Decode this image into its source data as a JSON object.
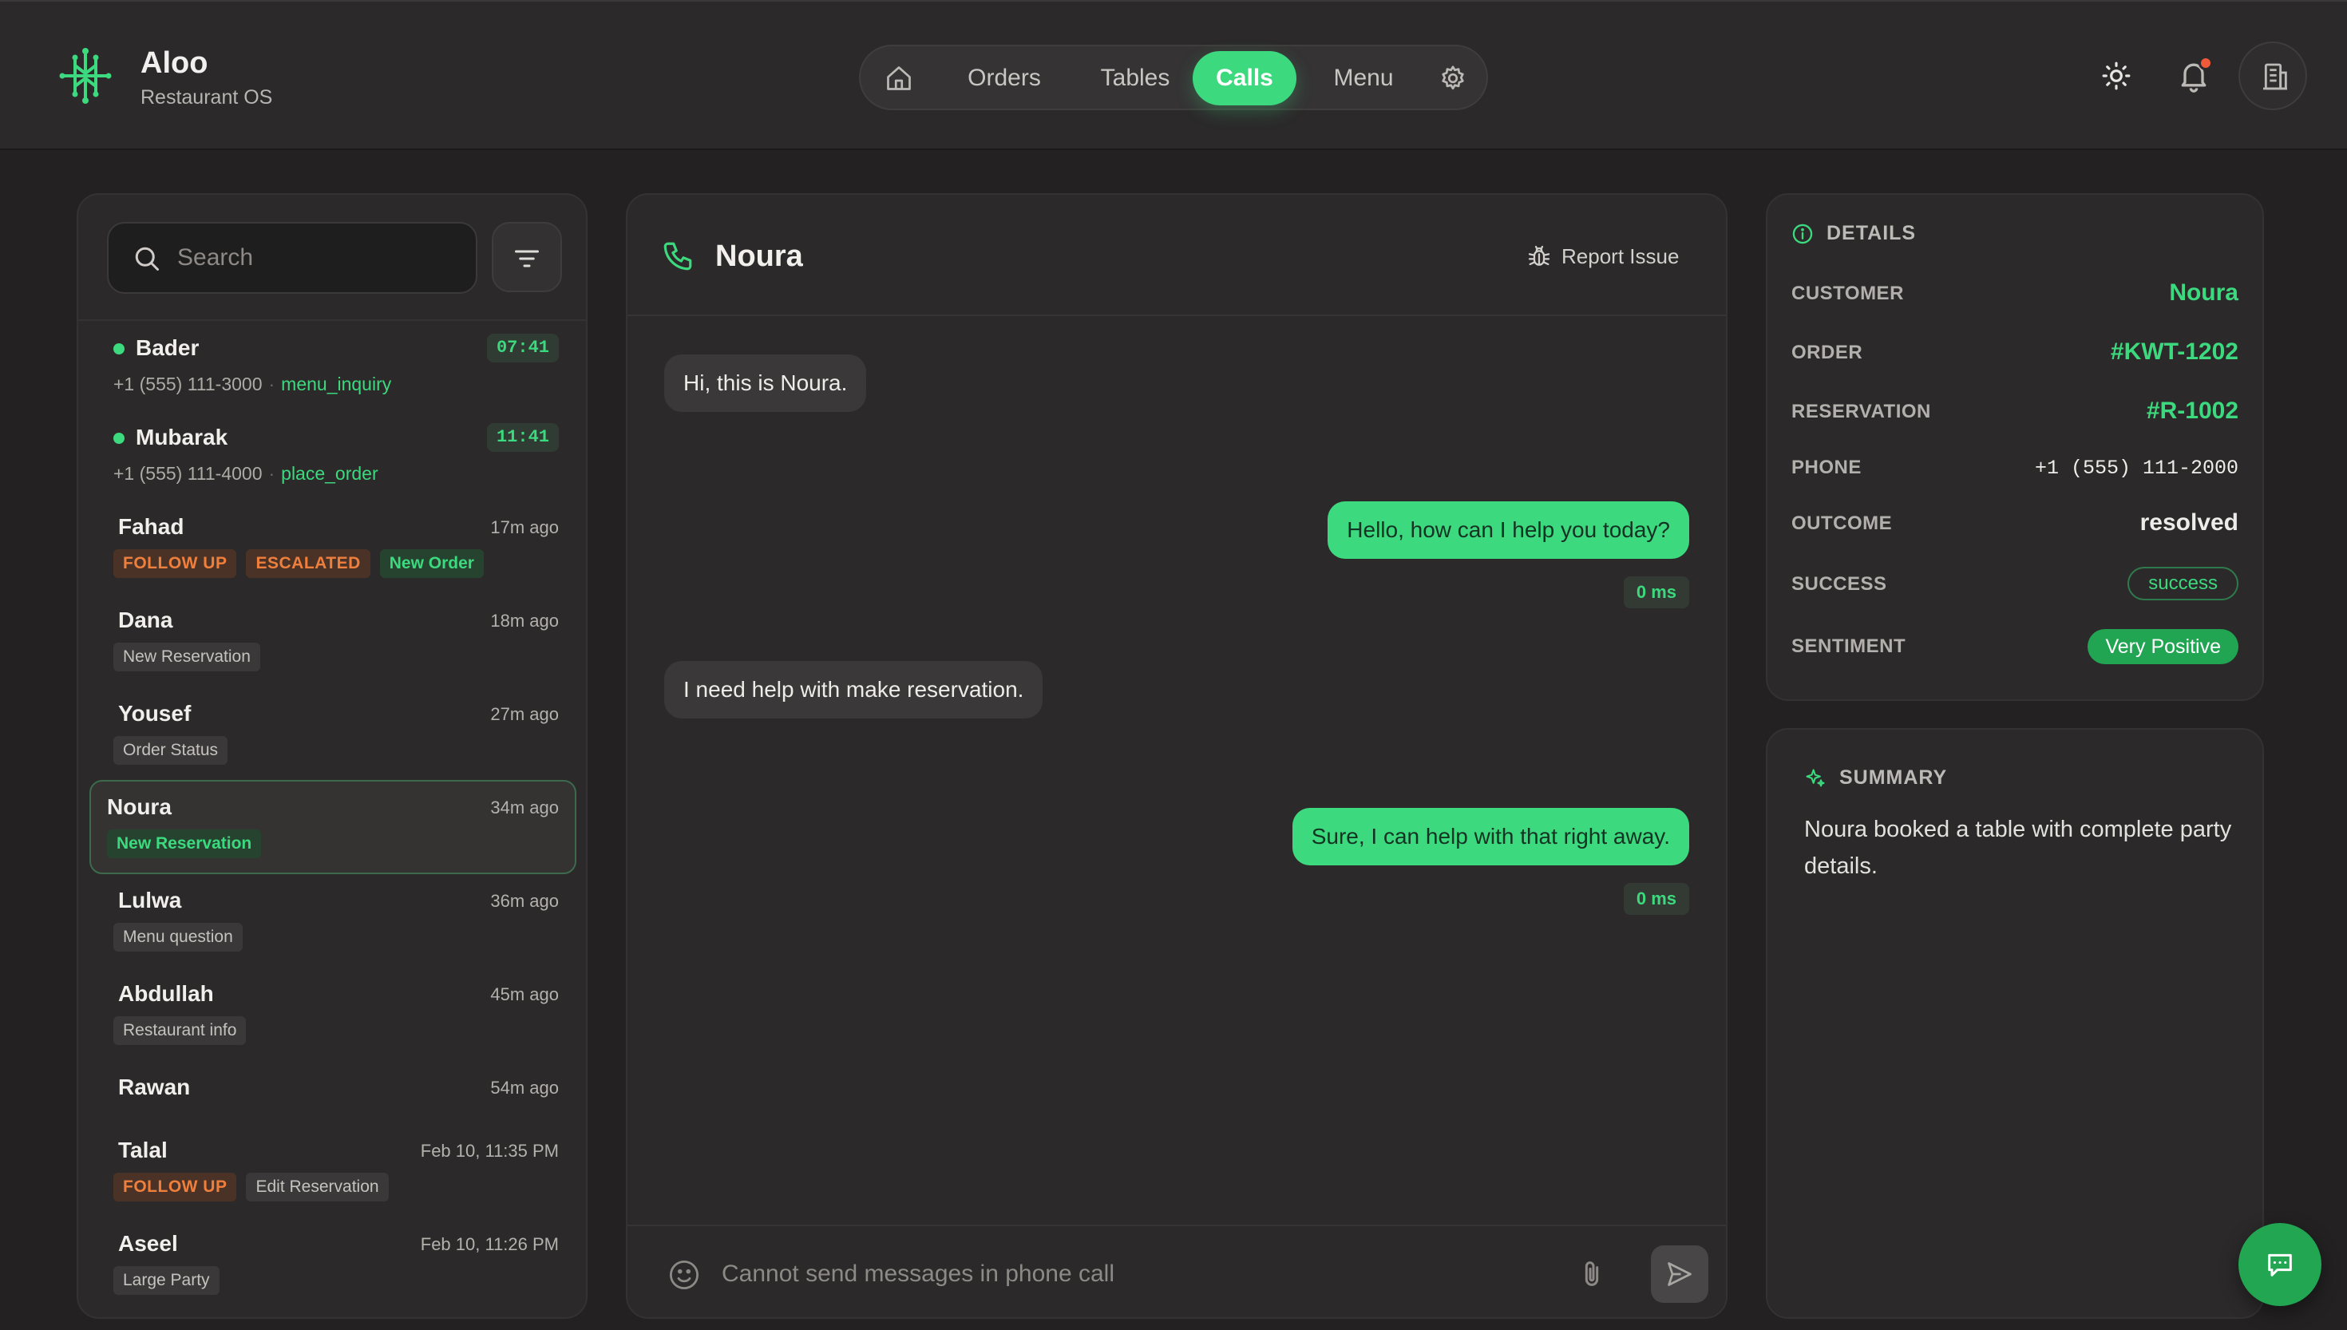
{
  "brand": {
    "name": "Aloo",
    "subtitle": "Restaurant OS"
  },
  "nav": {
    "items": [
      {
        "label": "Orders"
      },
      {
        "label": "Tables"
      },
      {
        "label": "Calls",
        "active": true
      },
      {
        "label": "Menu"
      }
    ]
  },
  "colors": {
    "accent": "#3cd97e",
    "warning": "#ef7f3d",
    "notification_dot": "#ef5a3a"
  },
  "icons": [
    "logo-icon",
    "home-icon",
    "gear-icon",
    "sun-icon",
    "bell-icon",
    "building-icon",
    "search-icon",
    "filter-icon",
    "phone-icon",
    "bug-icon",
    "emoji-icon",
    "paperclip-icon",
    "send-icon",
    "info-icon",
    "sparkle-icon",
    "chat-icon"
  ],
  "search": {
    "placeholder": "Search"
  },
  "calls": [
    {
      "name": "Bader",
      "live": true,
      "timer": "07:41",
      "phone": "+1 (555) 111-3000",
      "intent": "menu_inquiry"
    },
    {
      "name": "Mubarak",
      "live": true,
      "timer": "11:41",
      "phone": "+1 (555) 111-4000",
      "intent": "place_order"
    },
    {
      "name": "Fahad",
      "time": "17m ago",
      "tags": [
        "FOLLOW UP",
        "ESCALATED",
        "New Order"
      ]
    },
    {
      "name": "Dana",
      "time": "18m ago",
      "tags": [
        "New Reservation"
      ]
    },
    {
      "name": "Yousef",
      "time": "27m ago",
      "tags": [
        "Order Status"
      ]
    },
    {
      "name": "Noura",
      "time": "34m ago",
      "tags": [
        "New Reservation"
      ],
      "selected": true
    },
    {
      "name": "Lulwa",
      "time": "36m ago",
      "tags": [
        "Menu question"
      ]
    },
    {
      "name": "Abdullah",
      "time": "45m ago",
      "tags": [
        "Restaurant info"
      ]
    },
    {
      "name": "Rawan",
      "time": "54m ago",
      "tags": []
    },
    {
      "name": "Talal",
      "time": "Feb 10, 11:35 PM",
      "tags": [
        "FOLLOW UP",
        "Edit Reservation"
      ]
    },
    {
      "name": "Aseel",
      "time": "Feb 10, 11:26 PM",
      "tags": [
        "Large Party"
      ]
    }
  ],
  "chat": {
    "title": "Noura",
    "report_label": "Report Issue",
    "messages": [
      {
        "side": "in",
        "text": "Hi, this is Noura."
      },
      {
        "side": "out",
        "text": "Hello, how can I help you today?",
        "latency": "0 ms"
      },
      {
        "side": "in",
        "text": "I need help with make reservation."
      },
      {
        "side": "out",
        "text": "Sure, I can help with that right away.",
        "latency": "0 ms"
      }
    ],
    "composer_placeholder": "Cannot send messages in phone call"
  },
  "details": {
    "title": "DETAILS",
    "rows": [
      {
        "label": "CUSTOMER",
        "value": "Noura"
      },
      {
        "label": "ORDER",
        "value": "#KWT-1202"
      },
      {
        "label": "RESERVATION",
        "value": "#R-1002"
      },
      {
        "label": "PHONE",
        "value": "+1 (555) 111-2000"
      },
      {
        "label": "OUTCOME",
        "value": "resolved"
      },
      {
        "label": "SUCCESS",
        "value": "success"
      },
      {
        "label": "SENTIMENT",
        "value": "Very Positive"
      }
    ]
  },
  "summary": {
    "title": "SUMMARY",
    "text": "Noura booked a table with complete party details."
  }
}
